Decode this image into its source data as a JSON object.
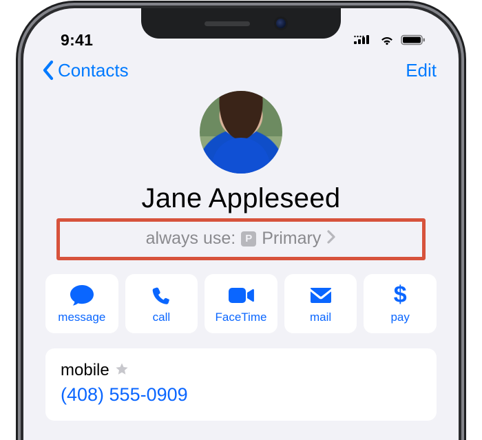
{
  "status": {
    "time": "9:41"
  },
  "nav": {
    "back_label": "Contacts",
    "edit_label": "Edit"
  },
  "contact": {
    "name": "Jane Appleseed"
  },
  "always_use": {
    "label": "always use:",
    "badge": "P",
    "value": "Primary"
  },
  "actions": {
    "message": "message",
    "call": "call",
    "facetime": "FaceTime",
    "mail": "mail",
    "pay": "pay"
  },
  "phone": {
    "label": "mobile",
    "number": "(408) 555-0909"
  },
  "colors": {
    "accent": "#007aff",
    "highlight_border": "#d7533c"
  }
}
